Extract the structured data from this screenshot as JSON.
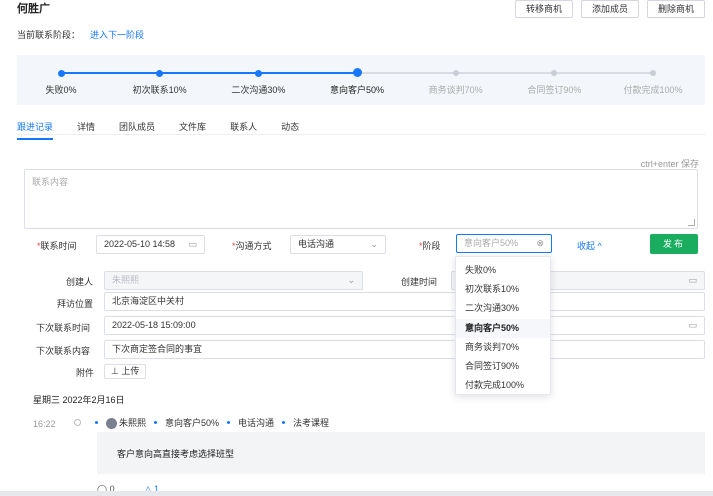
{
  "header": {
    "title": "何胜广",
    "actions": [
      "转移商机",
      "添加成员",
      "删除商机"
    ]
  },
  "stage": {
    "label": "当前联系阶段：",
    "next_link": "进入下一阶段"
  },
  "progress": {
    "steps": [
      "失败0%",
      "初次联系10%",
      "二次沟通30%",
      "意向客户50%",
      "商务谈判70%",
      "合同签订90%",
      "付款完成100%"
    ],
    "current_index": 3
  },
  "tabs": [
    "跟进记录",
    "详情",
    "团队成员",
    "文件库",
    "联系人",
    "动态"
  ],
  "editor": {
    "save_hint": "ctrl+enter 保存",
    "placeholder": "联系内容"
  },
  "quick_fields": {
    "contact_time_label": "联系时间",
    "contact_time_value": "2022-05-10 14:58",
    "method_label": "沟通方式",
    "method_value": "电话沟通",
    "stage_label": "阶段",
    "stage_value": "意向客户50%",
    "collapse": "收起",
    "publish": "发布"
  },
  "form": {
    "creator_label": "创建人",
    "creator_value": "朱熙熙",
    "created_time_label": "创建时间",
    "visit_location_label": "拜访位置",
    "visit_location_value": "北京海淀区中关村",
    "next_time_label": "下次联系时间",
    "next_time_value": "2022-05-18 15:09:00",
    "next_content_label": "下次联系内容",
    "next_content_value": "下次商定签合同的事宜",
    "attachment_label": "附件",
    "upload": "上传"
  },
  "dropdown": {
    "options": [
      "失败0%",
      "初次联系10%",
      "二次沟通30%",
      "意向客户50%",
      "商务谈判70%",
      "合同签订90%",
      "付款完成100%"
    ],
    "selected_index": 3
  },
  "timeline": {
    "date": "星期三 2022年2月16日",
    "time": "16:22",
    "user": "朱熙熙",
    "stage": "意向客户50%",
    "method": "电话沟通",
    "course": "法考课程",
    "content": "客户意向高直接考虑选择班型",
    "comments": "0",
    "likes": "1"
  },
  "colors": {
    "accent": "#1677ff",
    "publish": "#1aad5f",
    "required": "#e94343"
  }
}
